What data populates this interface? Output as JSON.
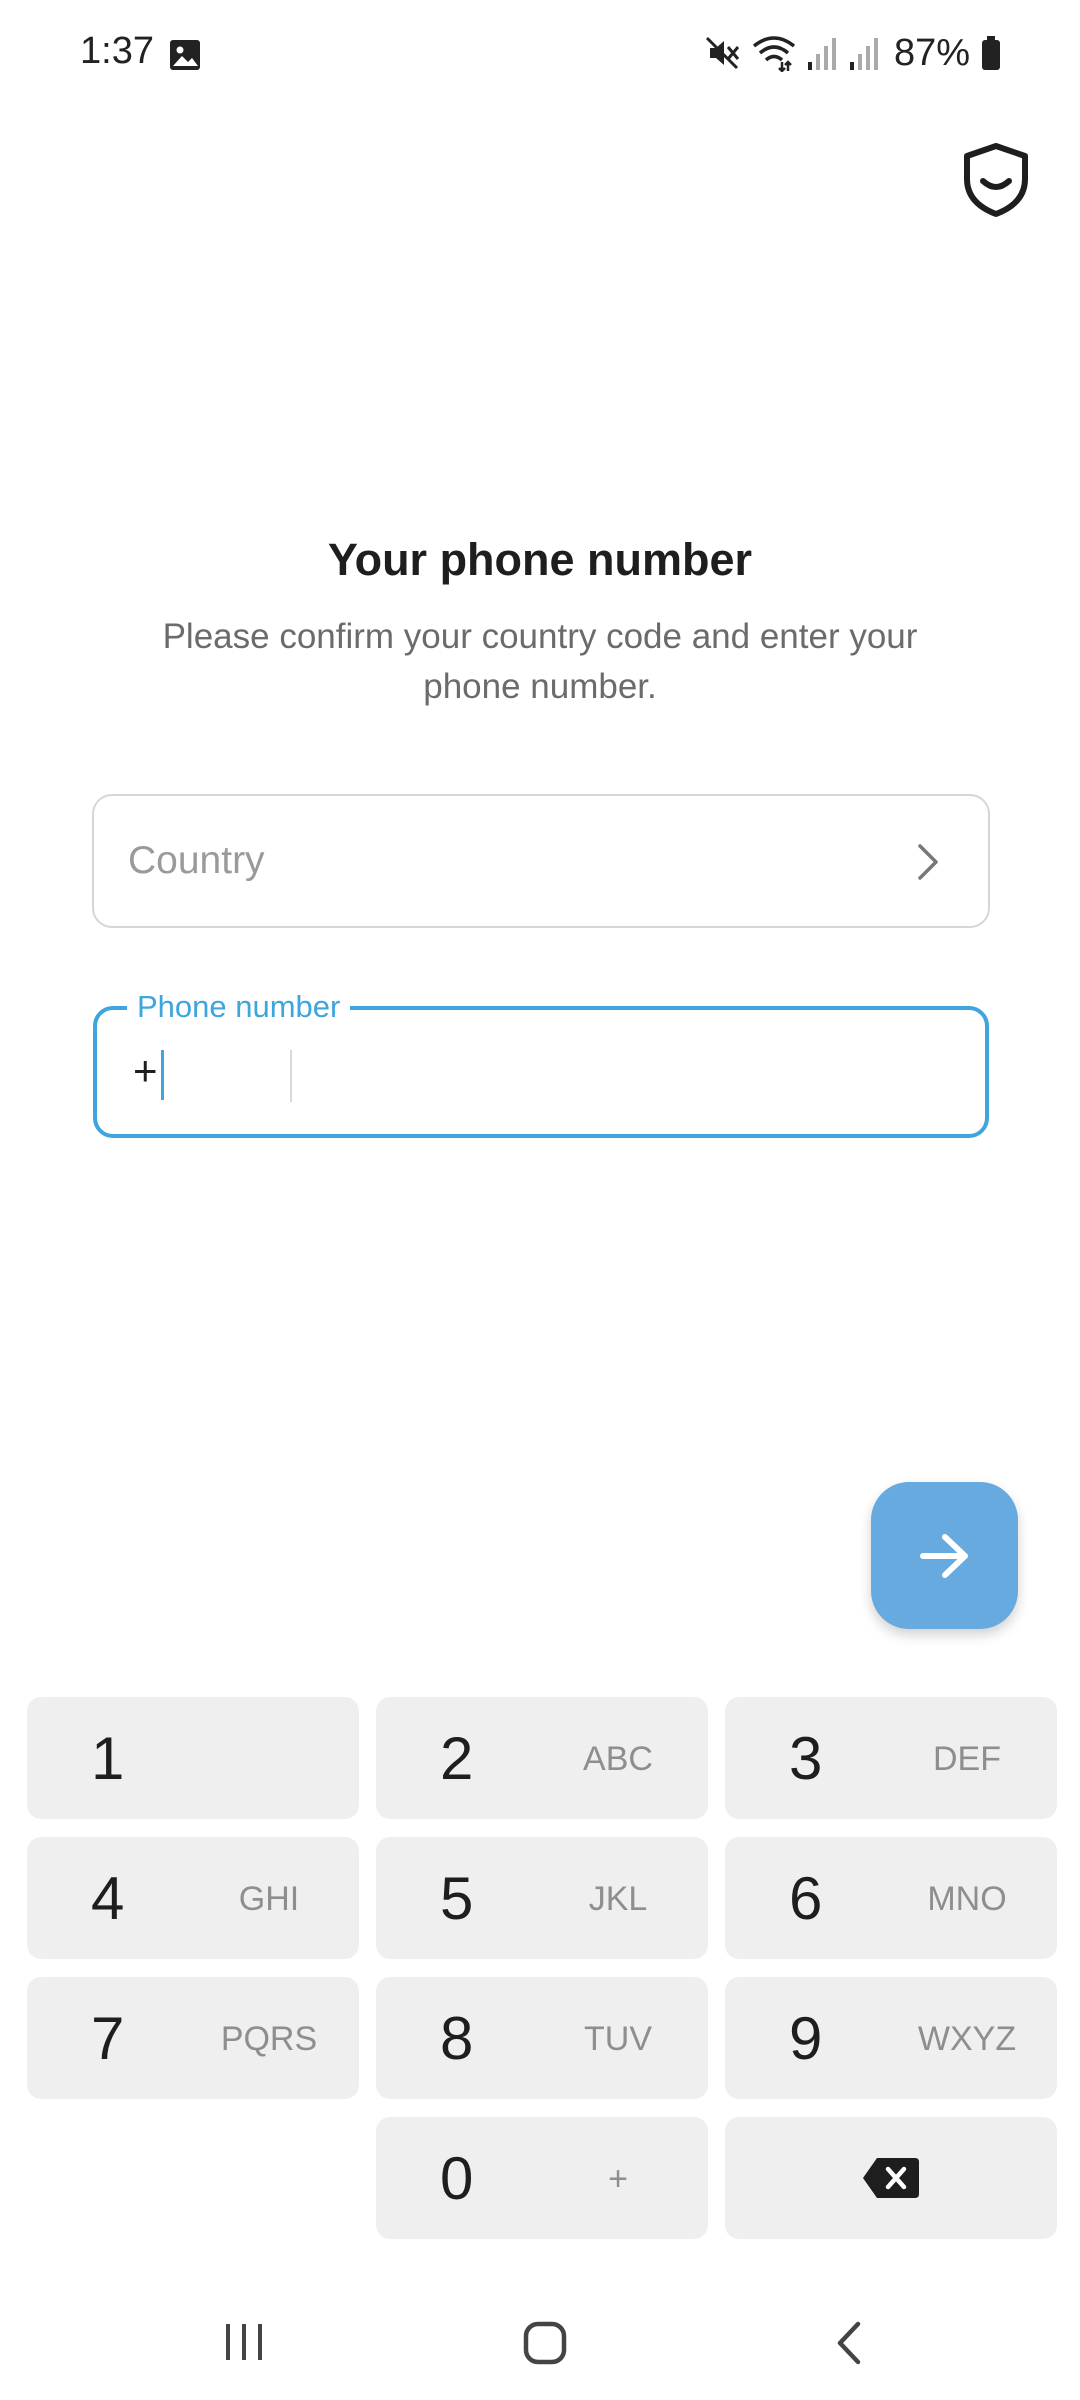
{
  "status_bar": {
    "time": "1:37",
    "battery": "87%",
    "icons": [
      "gallery-icon",
      "mute-icon",
      "wifi-icon",
      "signal-icon",
      "signal-icon",
      "battery-icon"
    ]
  },
  "header": {
    "shield_icon": "shield-icon"
  },
  "main": {
    "title": "Your phone number",
    "subtitle": "Please confirm your country code and enter your phone number.",
    "country": {
      "placeholder": "Country",
      "value": ""
    },
    "phone": {
      "label": "Phone number",
      "prefix": "+",
      "code": "",
      "number": ""
    },
    "next_icon": "arrow-right-icon"
  },
  "keypad": {
    "keys": [
      {
        "digit": "1",
        "letters": ""
      },
      {
        "digit": "2",
        "letters": "ABC"
      },
      {
        "digit": "3",
        "letters": "DEF"
      },
      {
        "digit": "4",
        "letters": "GHI"
      },
      {
        "digit": "5",
        "letters": "JKL"
      },
      {
        "digit": "6",
        "letters": "MNO"
      },
      {
        "digit": "7",
        "letters": "PQRS"
      },
      {
        "digit": "8",
        "letters": "TUV"
      },
      {
        "digit": "9",
        "letters": "WXYZ"
      },
      {
        "digit": "0",
        "letters": "+"
      }
    ],
    "backspace_icon": "backspace-icon"
  },
  "colors": {
    "accent": "#3ea5dd",
    "fab": "#66aae0",
    "key_bg": "#efefef"
  }
}
